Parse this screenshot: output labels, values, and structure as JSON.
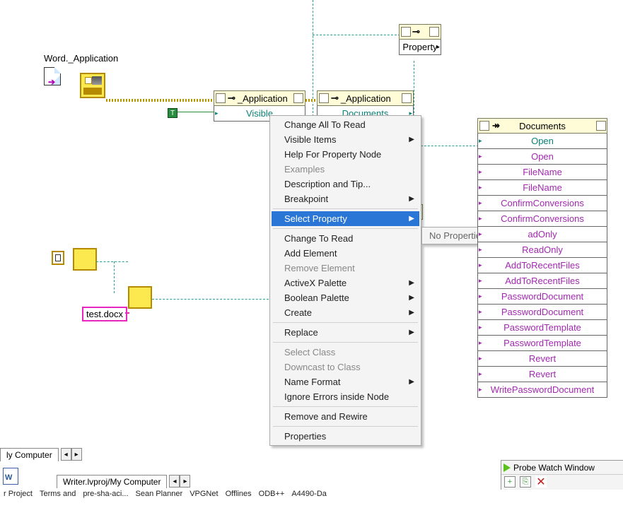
{
  "labels": {
    "wordApp": "Word._Application",
    "testDoc": "test.docx"
  },
  "nodes": {
    "property": {
      "label": "Property"
    },
    "app1": {
      "header": "_Application",
      "row": "Visible"
    },
    "app2": {
      "header": "_Application",
      "row": "Documents"
    },
    "documents": {
      "header": "Documents",
      "rows": [
        {
          "text": "Open",
          "cls": "txt-teal"
        },
        {
          "text": "Open",
          "cls": "txt-purple"
        },
        {
          "text": "FileName",
          "cls": "txt-purple"
        },
        {
          "text": "FileName",
          "cls": "txt-purple"
        },
        {
          "text": "ConfirmConversions",
          "cls": "txt-purple"
        },
        {
          "text": "ConfirmConversions",
          "cls": "txt-purple"
        },
        {
          "text": "adOnly",
          "cls": "txt-purple"
        },
        {
          "text": "ReadOnly",
          "cls": "txt-purple"
        },
        {
          "text": "AddToRecentFiles",
          "cls": "txt-purple"
        },
        {
          "text": "AddToRecentFiles",
          "cls": "txt-purple"
        },
        {
          "text": "PasswordDocument",
          "cls": "txt-purple"
        },
        {
          "text": "PasswordDocument",
          "cls": "txt-purple"
        },
        {
          "text": "PasswordTemplate",
          "cls": "txt-purple"
        },
        {
          "text": "PasswordTemplate",
          "cls": "txt-purple"
        },
        {
          "text": "Revert",
          "cls": "txt-purple"
        },
        {
          "text": "Revert",
          "cls": "txt-purple"
        },
        {
          "text": "WritePasswordDocument",
          "cls": "txt-purple"
        }
      ]
    }
  },
  "contextMenu": {
    "items": [
      {
        "label": "Change All To Read",
        "disabled": false,
        "sub": false
      },
      {
        "label": "Visible Items",
        "disabled": false,
        "sub": true
      },
      {
        "label": "Help For Property Node",
        "disabled": false,
        "sub": false
      },
      {
        "label": "Examples",
        "disabled": true,
        "sub": false
      },
      {
        "label": "Description and Tip...",
        "disabled": false,
        "sub": false
      },
      {
        "label": "Breakpoint",
        "disabled": false,
        "sub": true
      },
      {
        "sep": true
      },
      {
        "label": "Select Property",
        "disabled": false,
        "sub": true,
        "highlighted": true
      },
      {
        "sep": true
      },
      {
        "label": "Change To Read",
        "disabled": false,
        "sub": false
      },
      {
        "label": "Add Element",
        "disabled": false,
        "sub": false
      },
      {
        "label": "Remove Element",
        "disabled": true,
        "sub": false
      },
      {
        "label": "ActiveX Palette",
        "disabled": false,
        "sub": true
      },
      {
        "label": "Boolean Palette",
        "disabled": false,
        "sub": true
      },
      {
        "label": "Create",
        "disabled": false,
        "sub": true
      },
      {
        "sep": true
      },
      {
        "label": "Replace",
        "disabled": false,
        "sub": true
      },
      {
        "sep": true
      },
      {
        "label": "Select Class",
        "disabled": true,
        "sub": false
      },
      {
        "label": "Downcast to Class",
        "disabled": true,
        "sub": false
      },
      {
        "label": "Name Format",
        "disabled": false,
        "sub": true
      },
      {
        "label": "Ignore Errors inside Node",
        "disabled": false,
        "sub": false
      },
      {
        "sep": true
      },
      {
        "label": "Remove and Rewire",
        "disabled": false,
        "sub": false
      },
      {
        "sep": true
      },
      {
        "label": "Properties",
        "disabled": false,
        "sub": false
      }
    ],
    "submenuLabel": "No Properties"
  },
  "greenConst": "T",
  "bottom": {
    "tab1": "ly Computer",
    "tab2": "Writer.lvproj/My Computer",
    "items": [
      "r Project",
      "Terms and",
      "pre-sha-aci...",
      "Sean Planner",
      "VPGNet",
      "Offlines",
      "ODB++",
      "A4490-Da"
    ]
  },
  "probe": {
    "title": "Probe Watch Window"
  }
}
